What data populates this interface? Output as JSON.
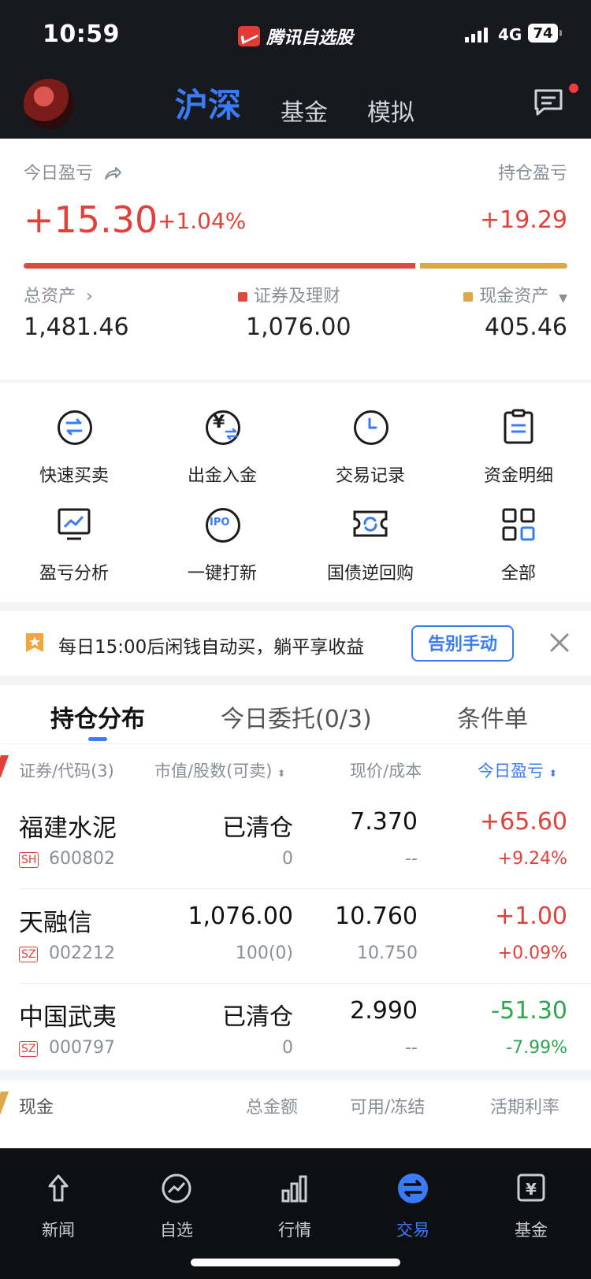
{
  "status_bar": {
    "time": "10:59",
    "app_name": "腾讯自选股",
    "network": "4G",
    "battery": "74"
  },
  "nav": {
    "tabs": [
      "沪深",
      "基金",
      "模拟"
    ],
    "active_tab": "沪深"
  },
  "summary": {
    "today_pnl_label": "今日盈亏",
    "today_pnl": "+15.30",
    "today_pnl_pct": "+1.04%",
    "position_pnl_label": "持仓盈亏",
    "position_pnl": "+19.29",
    "securities_ratio": 0.726,
    "total_assets_label": "总资产",
    "total_assets": "1,481.46",
    "securities_label": "证券及理财",
    "securities": "1,076.00",
    "cash_label": "现金资产",
    "cash": "405.46",
    "colors": {
      "profit": "#e2403a",
      "securities": "#dd4a42",
      "cash": "#dba94a"
    }
  },
  "shortcuts": [
    {
      "label": "快速买卖",
      "icon": "swap-icon"
    },
    {
      "label": "出金入金",
      "icon": "yuan-transfer-icon"
    },
    {
      "label": "交易记录",
      "icon": "clock-icon"
    },
    {
      "label": "资金明细",
      "icon": "clipboard-icon"
    },
    {
      "label": "盈亏分析",
      "icon": "chart-monitor-icon"
    },
    {
      "label": "一键打新",
      "icon": "ipo-icon"
    },
    {
      "label": "国债逆回购",
      "icon": "bond-repo-icon"
    },
    {
      "label": "全部",
      "icon": "grid-icon"
    }
  ],
  "promo": {
    "text": "每日15:00后闲钱自动买，躺平享收益",
    "button": "告别手动"
  },
  "holdings": {
    "tabs": [
      "持仓分布",
      "今日委托(0/3)",
      "条件单"
    ],
    "active_tab": "持仓分布",
    "headers": [
      "证券/代码(3)",
      "市值/股数(可卖)",
      "现价/成本",
      "今日盈亏"
    ],
    "rows": [
      {
        "name": "福建水泥",
        "market": "SH",
        "code": "600802",
        "value": "已清仓",
        "shares": "0",
        "price": "7.370",
        "cost": "--",
        "pnl": "+65.60",
        "pnl_pct": "+9.24%",
        "dir": "pos"
      },
      {
        "name": "天融信",
        "market": "SZ",
        "code": "002212",
        "value": "1,076.00",
        "shares": "100(0)",
        "price": "10.760",
        "cost": "10.750",
        "pnl": "+1.00",
        "pnl_pct": "+0.09%",
        "dir": "pos"
      },
      {
        "name": "中国武夷",
        "market": "SZ",
        "code": "000797",
        "value": "已清仓",
        "shares": "0",
        "price": "2.990",
        "cost": "--",
        "pnl": "-51.30",
        "pnl_pct": "-7.99%",
        "dir": "neg"
      }
    ]
  },
  "cash_section": {
    "headers": [
      "现金",
      "总金额",
      "可用/冻结",
      "活期利率"
    ]
  },
  "bottom_nav": [
    {
      "label": "新闻",
      "icon": "news-icon"
    },
    {
      "label": "自选",
      "icon": "watchlist-icon"
    },
    {
      "label": "行情",
      "icon": "market-icon"
    },
    {
      "label": "交易",
      "icon": "trade-icon"
    },
    {
      "label": "基金",
      "icon": "fund-icon"
    }
  ],
  "bottom_active": "交易"
}
